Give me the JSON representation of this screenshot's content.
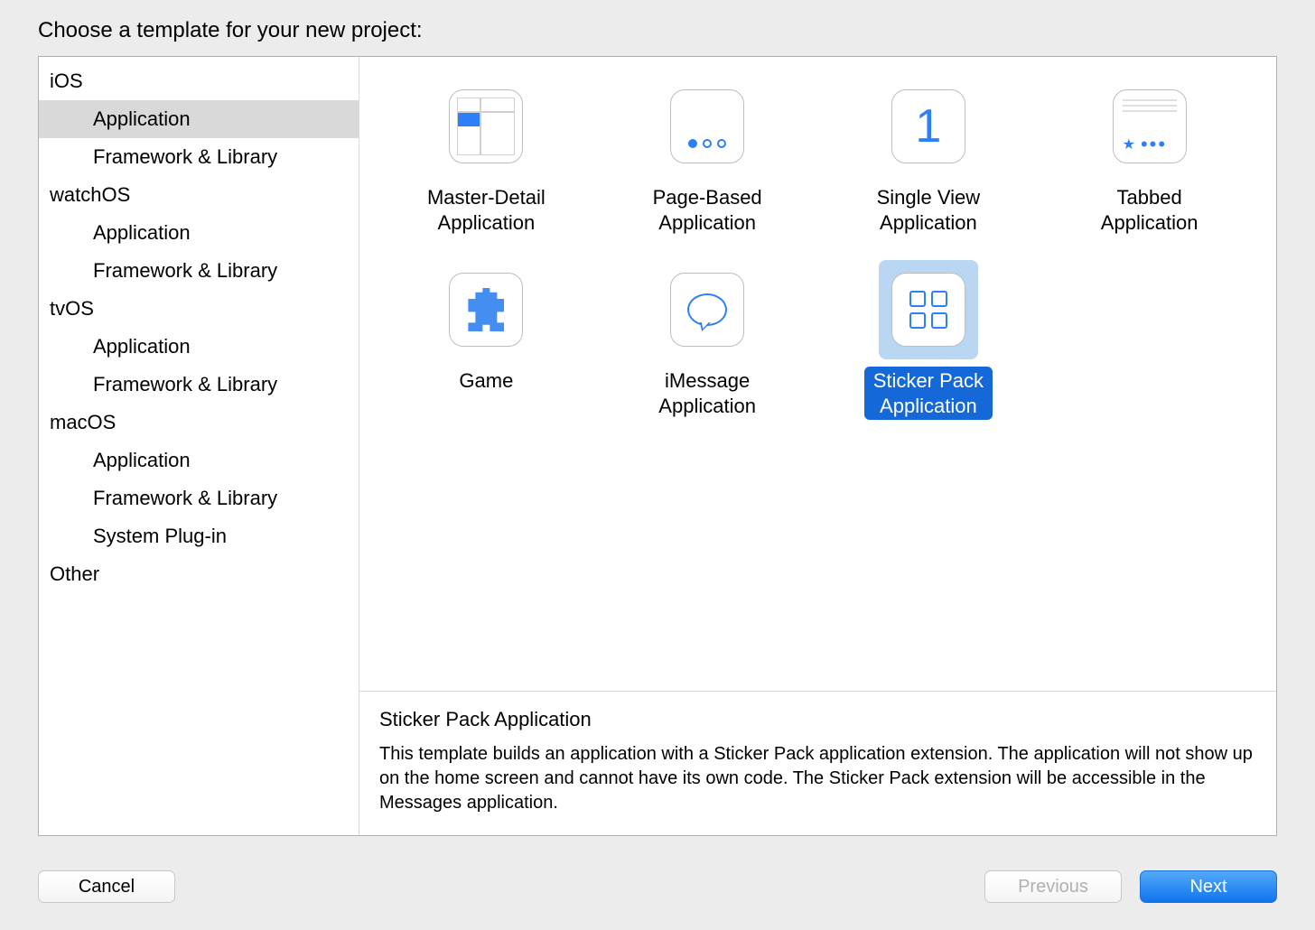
{
  "prompt": "Choose a template for your new project:",
  "sidebar": [
    {
      "header": "iOS",
      "items": [
        "Application",
        "Framework & Library"
      ],
      "selectedIndex": 0
    },
    {
      "header": "watchOS",
      "items": [
        "Application",
        "Framework & Library"
      ]
    },
    {
      "header": "tvOS",
      "items": [
        "Application",
        "Framework & Library"
      ]
    },
    {
      "header": "macOS",
      "items": [
        "Application",
        "Framework & Library",
        "System Plug-in"
      ]
    },
    {
      "header": "Other",
      "items": []
    }
  ],
  "templates": [
    {
      "id": "master-detail",
      "label": "Master-Detail\nApplication"
    },
    {
      "id": "page-based",
      "label": "Page-Based\nApplication"
    },
    {
      "id": "single-view",
      "label": "Single View\nApplication"
    },
    {
      "id": "tabbed",
      "label": "Tabbed\nApplication"
    },
    {
      "id": "game",
      "label": "Game"
    },
    {
      "id": "imessage",
      "label": "iMessage\nApplication"
    },
    {
      "id": "sticker-pack",
      "label": "Sticker Pack\nApplication",
      "selected": true
    }
  ],
  "description": {
    "title": "Sticker Pack Application",
    "body": "This template builds an application with a Sticker Pack application extension. The application will not show up on the home screen and cannot have its own code. The Sticker Pack extension will be accessible in the Messages application."
  },
  "buttons": {
    "cancel": "Cancel",
    "previous": "Previous",
    "next": "Next"
  }
}
